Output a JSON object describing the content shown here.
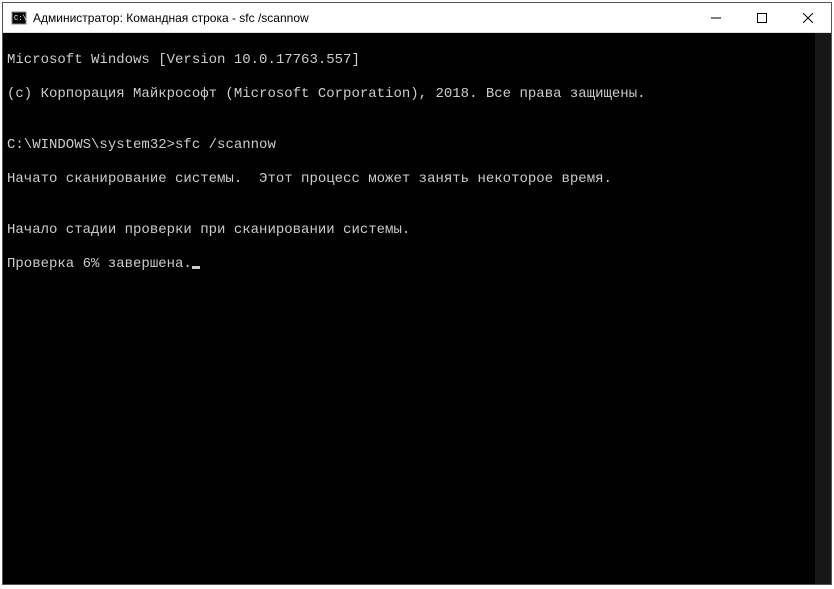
{
  "window": {
    "title": "Администратор: Командная строка - sfc  /scannow"
  },
  "console": {
    "line1": "Microsoft Windows [Version 10.0.17763.557]",
    "line2": "(c) Корпорация Майкрософт (Microsoft Corporation), 2018. Все права защищены.",
    "blank1": "",
    "prompt": "C:\\WINDOWS\\system32>",
    "command": "sfc /scannow",
    "blank2": "",
    "line3": "Начато сканирование системы.  Этот процесс может занять некоторое время.",
    "blank3": "",
    "line4": "Начало стадии проверки при сканировании системы.",
    "line5": "Проверка 6% завершена."
  }
}
